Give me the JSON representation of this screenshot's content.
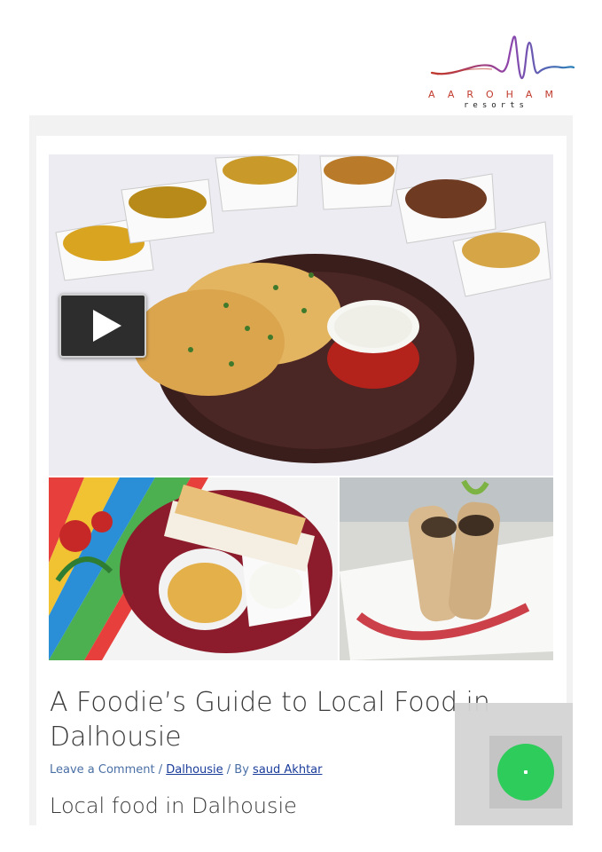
{
  "brand": {
    "word": "AAROHAM",
    "sub": "resorts"
  },
  "post": {
    "title": "A Foodie’s Guide to Local Food in Dalhousie",
    "meta": {
      "comment_link": "Leave a Comment",
      "separator1": " / ",
      "category_link": "Dalhousie",
      "separator2": " / By ",
      "author_link": "saud Akhtar"
    },
    "section_heading": "Local food in Dalhousie"
  },
  "colors": {
    "accent_link": "#1a3c9a",
    "chat_green": "#2ecc5a",
    "logo_gradient": [
      "#c0392b",
      "#8e44ad",
      "#2980b9"
    ]
  },
  "icons": {
    "play": "play-icon",
    "chat": "chat-icon"
  }
}
